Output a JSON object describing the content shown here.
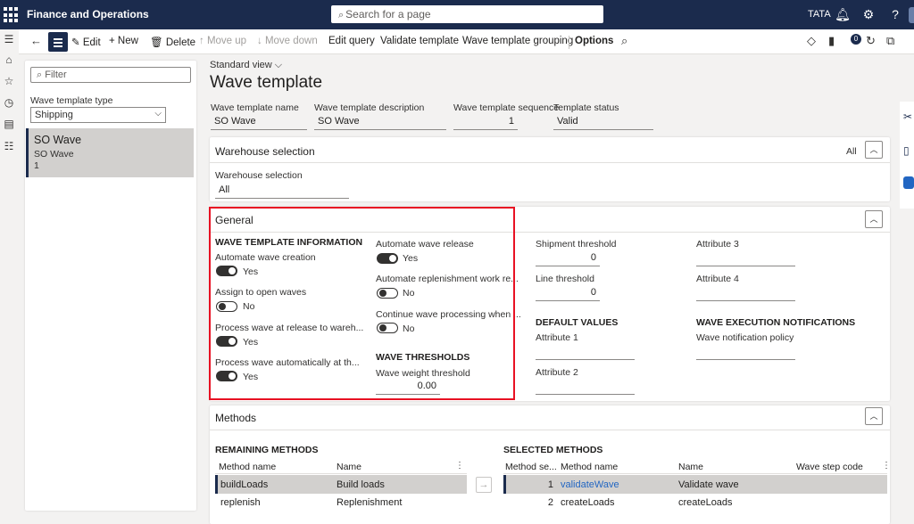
{
  "app": {
    "title": "Finance and Operations",
    "search_placeholder": "Search for a page",
    "company": "TATA",
    "notification_count": "0"
  },
  "toolbar": {
    "edit": "Edit",
    "new": "New",
    "delete": "Delete",
    "move_up": "Move up",
    "move_down": "Move down",
    "edit_query": "Edit query",
    "validate_template": "Validate template",
    "wave_template_grouping": "Wave template grouping",
    "options": "Options"
  },
  "list": {
    "filter_placeholder": "Filter",
    "wave_template_type_label": "Wave template type",
    "wave_template_type_value": "Shipping",
    "selected_item": {
      "title": "SO Wave",
      "subtitle": "SO Wave",
      "sequence": "1"
    }
  },
  "page": {
    "view": "Standard view",
    "title": "Wave template",
    "header": {
      "name_label": "Wave template name",
      "name_value": "SO Wave",
      "desc_label": "Wave template description",
      "desc_value": "SO Wave",
      "seq_label": "Wave template sequence",
      "seq_value": "1",
      "status_label": "Template status",
      "status_value": "Valid"
    }
  },
  "warehouse": {
    "title": "Warehouse selection",
    "summary": "All",
    "field_label": "Warehouse selection",
    "field_value": "All"
  },
  "general": {
    "title": "General",
    "wave_info_header": "WAVE TEMPLATE INFORMATION",
    "automate_creation_label": "Automate wave creation",
    "automate_creation_value": "Yes",
    "assign_open_label": "Assign to open waves",
    "assign_open_value": "No",
    "process_release_label": "Process wave at release to wareh...",
    "process_release_value": "Yes",
    "process_auto_label": "Process wave automatically at th...",
    "process_auto_value": "Yes",
    "automate_release_label": "Automate wave release",
    "automate_release_value": "Yes",
    "automate_replen_label": "Automate replenishment work re...",
    "automate_replen_value": "No",
    "continue_label": "Continue wave processing when ...",
    "continue_value": "No",
    "thresholds_header": "WAVE THRESHOLDS",
    "weight_label": "Wave weight threshold",
    "weight_value": "0.00",
    "shipment_label": "Shipment threshold",
    "shipment_value": "0",
    "line_label": "Line threshold",
    "line_value": "0",
    "default_values_header": "DEFAULT VALUES",
    "attr1_label": "Attribute 1",
    "attr2_label": "Attribute 2",
    "attr3_label": "Attribute 3",
    "attr4_label": "Attribute 4",
    "notifications_header": "WAVE EXECUTION NOTIFICATIONS",
    "notification_policy_label": "Wave notification policy"
  },
  "methods": {
    "title": "Methods",
    "remaining_header": "REMAINING METHODS",
    "remaining_columns": [
      "Method name",
      "Name"
    ],
    "remaining_rows": [
      {
        "method": "buildLoads",
        "name": "Build loads"
      },
      {
        "method": "replenish",
        "name": "Replenishment"
      }
    ],
    "selected_header": "SELECTED METHODS",
    "selected_columns": [
      "Method se...",
      "Method name",
      "Name",
      "Wave step code"
    ],
    "selected_rows": [
      {
        "seq": "1",
        "method": "validateWave",
        "name": "Validate wave",
        "step": ""
      },
      {
        "seq": "2",
        "method": "createLoads",
        "name": "createLoads",
        "step": ""
      }
    ]
  },
  "colors": {
    "nav": "#1b2b4d",
    "highlight_border": "#e81123",
    "link": "#2266c2",
    "selected_row": "#d2d0ce"
  }
}
